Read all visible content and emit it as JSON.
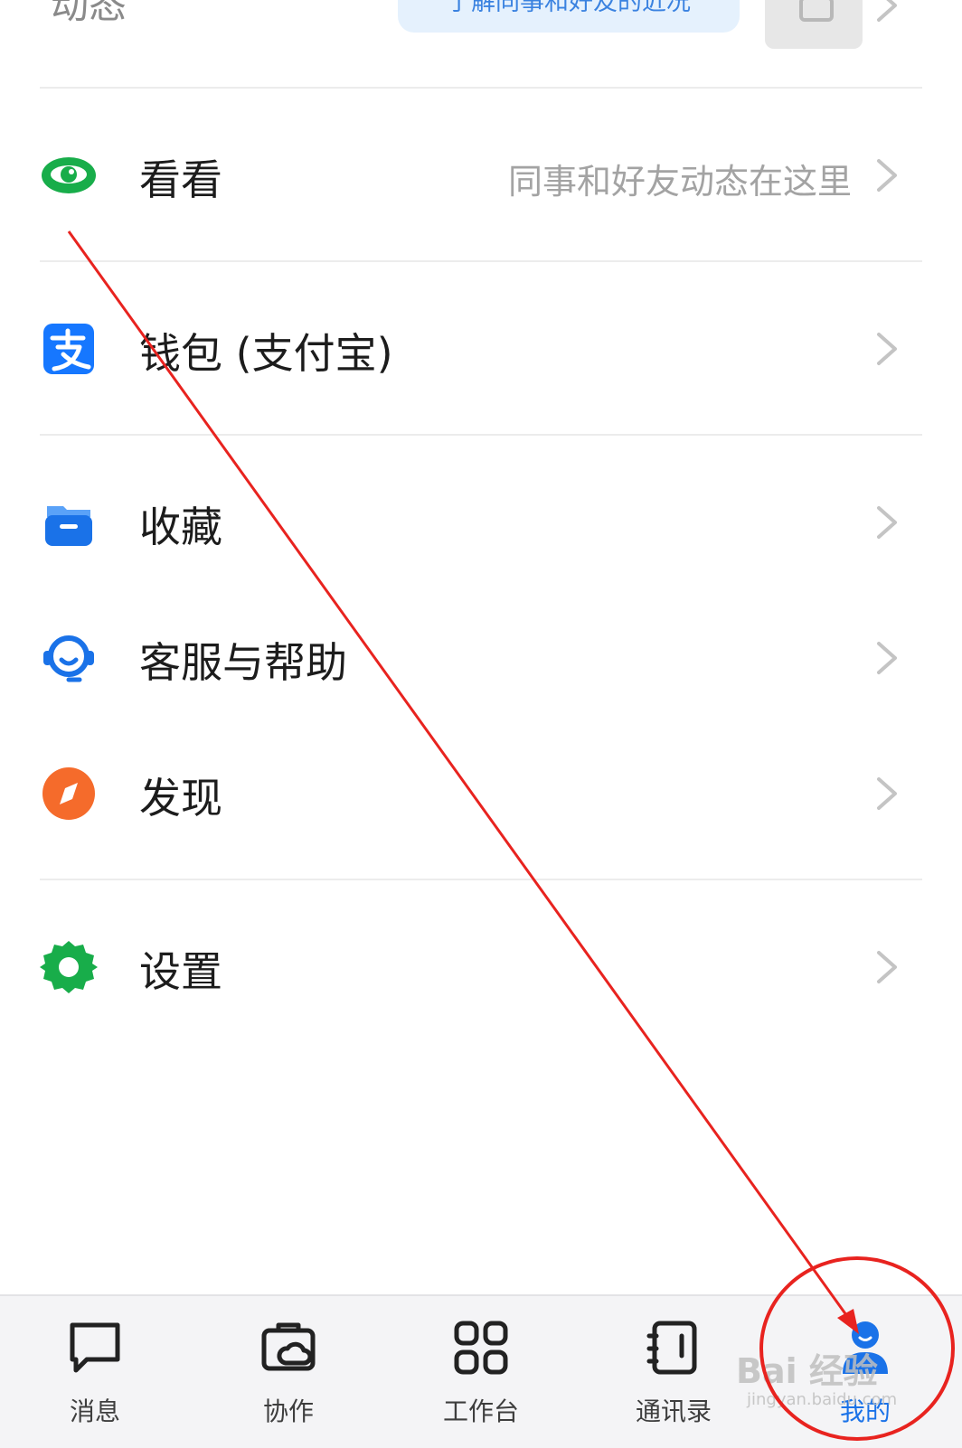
{
  "top_row": {
    "title": "动态",
    "bubble_text": "了解同事和好友的近况"
  },
  "menu": {
    "kankan": {
      "label": "看看",
      "subtitle": "同事和好友动态在这里"
    },
    "wallet": {
      "label": "钱包 (支付宝)"
    },
    "favorites": {
      "label": "收藏"
    },
    "support": {
      "label": "客服与帮助"
    },
    "discover": {
      "label": "发现"
    },
    "settings": {
      "label": "设置"
    }
  },
  "tabbar": {
    "messages": "消息",
    "collab": "协作",
    "workbench": "工作台",
    "contacts": "通讯录",
    "me": "我的",
    "active_tab": "我的"
  },
  "watermark": {
    "brand": "Bai 经验",
    "url": "jingyan.baidu.com"
  },
  "colors": {
    "accent_blue": "#1a72e8",
    "green": "#18ad4a",
    "orange": "#f56b2b",
    "annotation_red": "#e8231f"
  },
  "icons": {
    "kankan": "eye-icon",
    "wallet": "alipay-icon",
    "favorites": "folder-icon",
    "support": "headset-icon",
    "discover": "compass-icon",
    "settings": "gear-icon"
  }
}
